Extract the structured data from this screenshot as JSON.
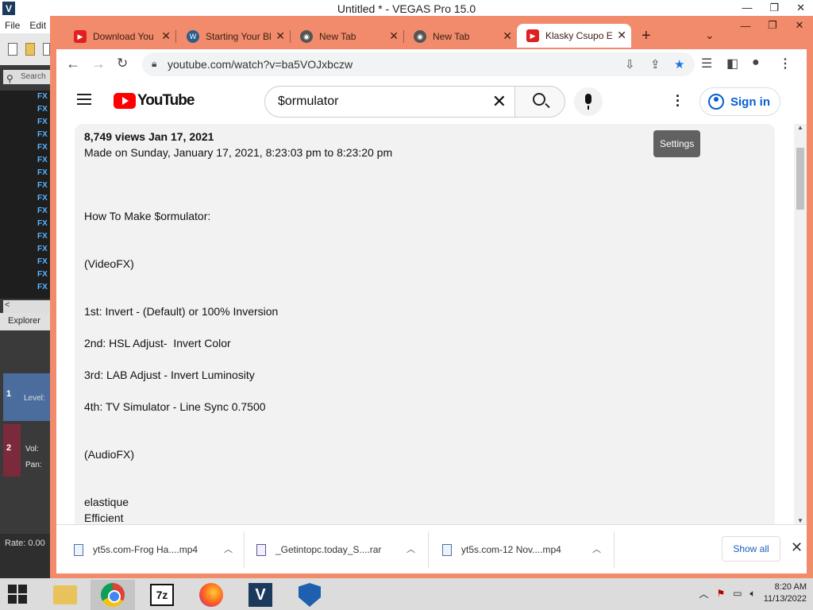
{
  "vegas": {
    "title": "Untitled * - VEGAS Pro 15.0",
    "logo": "V",
    "menu": [
      "File",
      "Edit"
    ],
    "search_placeholder": "Search",
    "fx_label": "FX",
    "explorer_tab": "Explorer",
    "track1_num": "1",
    "track1_label": "Level:",
    "track2_num": "2",
    "track2_vol": "Vol:",
    "track2_pan": "Pan:",
    "rate": "Rate: 0.00",
    "window_controls": [
      "—",
      "❐",
      "✕"
    ]
  },
  "browser": {
    "tabs": [
      {
        "title": "Download You",
        "icon": "youtube-icon"
      },
      {
        "title": "Starting Your Bl",
        "icon": "wordpress-icon"
      },
      {
        "title": "New Tab",
        "icon": "chrome-icon"
      },
      {
        "title": "New Tab",
        "icon": "chrome-icon"
      },
      {
        "title": "Klasky Csupo E",
        "icon": "youtube-icon",
        "active": true
      }
    ],
    "new_tab": "+",
    "tab_search": "⌄",
    "window_controls": [
      "—",
      "❐",
      "✕"
    ],
    "url": "youtube.com/watch?v=ba5VOJxbczw"
  },
  "youtube": {
    "logo_text": "YouTube",
    "search_query": "$ormulator",
    "sign_in": "Sign in",
    "tooltip": "Settings",
    "description": {
      "meta": "8,749 views  Jan 17, 2021",
      "made_on": "Made on Sunday, January 17, 2021, 8:23:03 pm to 8:23:20 pm",
      "how_to": "How To Make $ormulator:",
      "videofx_heading": "(VideoFX)",
      "step1": "1st: Invert - (Default) or 100% Inversion",
      "step2": "2nd: HSL Adjust-  Invert Color",
      "step3": "3rd: LAB Adjust - Invert Luminosity",
      "step4": "4th: TV Simulator - Line Sync 0.7500",
      "audiofx_heading": "(AudioFX)",
      "audio1": "elastique",
      "audio2": "Efficient"
    }
  },
  "downloads": {
    "items": [
      "yt5s.com-Frog Ha....mp4",
      "_Getintopc.today_S....rar",
      "yt5s.com-12 Nov....mp4"
    ],
    "show_all": "Show all"
  },
  "taskbar": {
    "time": "8:20 AM",
    "date": "11/13/2022",
    "zip_label": "7z",
    "vegas_label": "V"
  }
}
